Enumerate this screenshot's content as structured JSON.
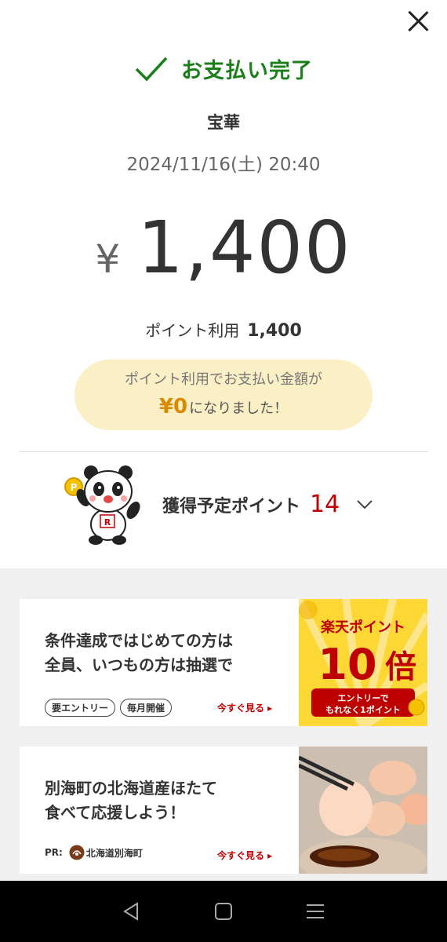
{
  "status": {
    "text": "お支払い完了",
    "color": "#1a7f1a"
  },
  "merchant": "宝華",
  "datetime": "2024/11/16(土) 20:40",
  "payment": {
    "currency": "¥",
    "amount": "1,400"
  },
  "points_used": {
    "label": "ポイント利用",
    "value": "1,400"
  },
  "notice": {
    "line1": "ポイント利用でお支払い金額が",
    "amount": "¥0",
    "line2_suffix": "になりました！"
  },
  "earned": {
    "label": "獲得予定ポイント",
    "value": "14",
    "value_color": "#bf0000"
  },
  "cards": [
    {
      "title_line1": "条件達成ではじめての方は",
      "title_line2": "全員、いつもの方は抽選で",
      "tags": [
        "要エントリー",
        "毎月開催"
      ],
      "link": "今すぐ見る ▸",
      "image": {
        "heading": "楽天ポイント",
        "big": "10",
        "big_suffix": "倍",
        "sub1": "エントリーで",
        "sub2": "もれなく1ポイント"
      }
    },
    {
      "title_line1": "別海町の北海道産ほたて",
      "title_line2": "食べて応援しよう！",
      "pr_label": "PR:",
      "sponsor": "北海道別海町",
      "link": "今すぐ見る ▸"
    }
  ],
  "icons": {
    "close": "close-icon",
    "check": "check-icon",
    "chevron": "chevron-down-icon",
    "back": "back-triangle-icon",
    "home": "home-square-icon",
    "menu": "menu-lines-icon"
  },
  "colors": {
    "accent_red": "#bf0000",
    "notice_bg": "#fbefc6",
    "success_green": "#1a7f1a",
    "zero_amount": "#d98a00"
  }
}
